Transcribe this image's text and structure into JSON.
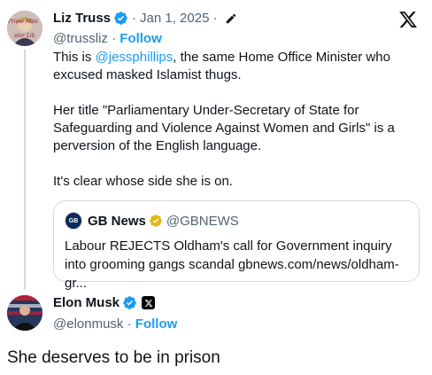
{
  "parent_tweet": {
    "author_name": "Liz Truss",
    "date": "Jan 1, 2025",
    "dot1": "·",
    "dot2": "·",
    "handle": "@trussliz",
    "sub_dot": "·",
    "follow_label": "Follow",
    "avatar_text": "Prime Mini",
    "avatar_text2": "ster Lib",
    "text_line1_prefix": "This is ",
    "mention": "@jessphillips",
    "text_line1_suffix": ", the same Home Office Minister who excused masked Islamist thugs.",
    "paragraph2": "Her title \"Parliamentary Under-Secretary of State for Safeguarding and Violence Against Women and Girls\" is a perversion of the English language.",
    "paragraph3": "It's clear whose side she is on."
  },
  "quoted_tweet": {
    "logo_text": "GB",
    "author_name": "GB News",
    "handle": "@GBNEWS",
    "text": "Labour REJECTS Oldham's call for Government inquiry into grooming gangs scandal gbnews.com/news/oldham-gr..."
  },
  "reply_tweet": {
    "author_name": "Elon Musk",
    "handle": "@elonmusk",
    "sub_dot": "·",
    "follow_label": "Follow",
    "text": "She deserves to be in prison"
  },
  "colors": {
    "accent_blue": "#1d9bf0",
    "secondary_text": "#536471",
    "border": "#cfd9de",
    "gold_verified": "#e2b719"
  },
  "icons": {
    "logo": "x-logo-icon",
    "verified": "verified-badge-icon",
    "edited": "edit-pencil-icon",
    "gold_verified": "gold-verified-badge-icon",
    "affiliate": "x-affiliate-badge-icon"
  }
}
